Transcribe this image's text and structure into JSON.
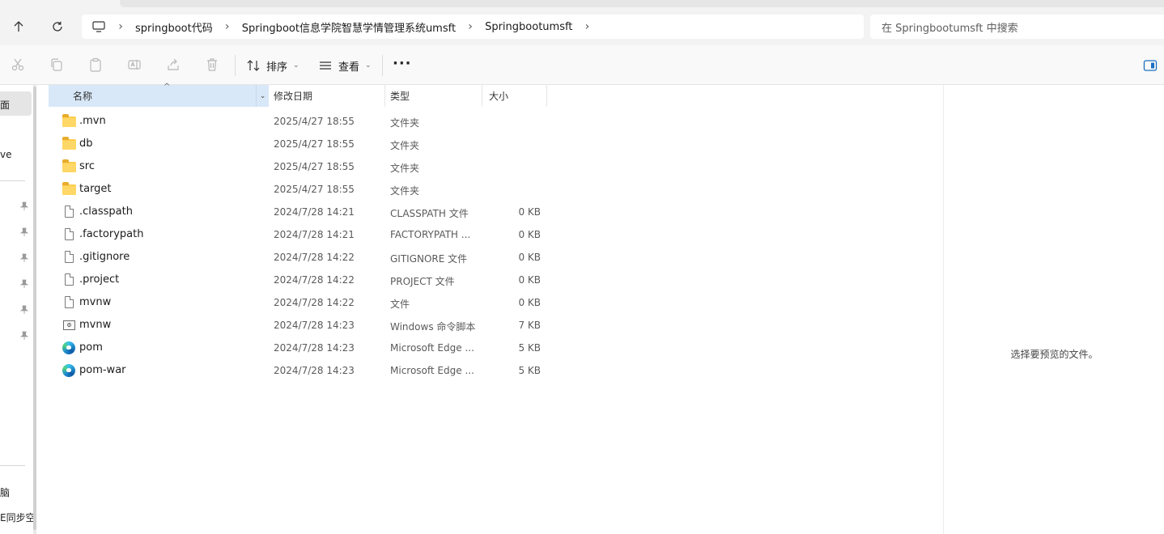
{
  "address": {
    "breadcrumbs": [
      "springboot代码",
      "Springboot信息学院智慧学情管理系统umsft",
      "Springbootumsft"
    ],
    "search_placeholder": "在 Springbootumsft 中搜索"
  },
  "toolbar": {
    "sort_label": "排序",
    "view_label": "查看",
    "more_label": "···"
  },
  "left_nav": {
    "selected_fragment": "面",
    "fragment_1": "ve",
    "fragment_2": "脑",
    "fragment_3": "E同步空"
  },
  "columns": {
    "name": "名称",
    "date": "修改日期",
    "type": "类型",
    "size": "大小"
  },
  "files": [
    {
      "name": ".mvn",
      "date": "2025/4/27 18:55",
      "type": "文件夹",
      "size": "",
      "icon": "folder-icon"
    },
    {
      "name": "db",
      "date": "2025/4/27 18:55",
      "type": "文件夹",
      "size": "",
      "icon": "folder-icon"
    },
    {
      "name": "src",
      "date": "2025/4/27 18:55",
      "type": "文件夹",
      "size": "",
      "icon": "folder-icon"
    },
    {
      "name": "target",
      "date": "2025/4/27 18:55",
      "type": "文件夹",
      "size": "",
      "icon": "folder-icon"
    },
    {
      "name": ".classpath",
      "date": "2024/7/28 14:21",
      "type": "CLASSPATH 文件",
      "size": "0 KB",
      "icon": "file-icon"
    },
    {
      "name": ".factorypath",
      "date": "2024/7/28 14:21",
      "type": "FACTORYPATH ...",
      "size": "0 KB",
      "icon": "file-icon"
    },
    {
      "name": ".gitignore",
      "date": "2024/7/28 14:22",
      "type": "GITIGNORE 文件",
      "size": "0 KB",
      "icon": "file-icon"
    },
    {
      "name": ".project",
      "date": "2024/7/28 14:22",
      "type": "PROJECT 文件",
      "size": "0 KB",
      "icon": "file-icon"
    },
    {
      "name": "mvnw",
      "date": "2024/7/28 14:22",
      "type": "文件",
      "size": "0 KB",
      "icon": "file-icon"
    },
    {
      "name": "mvnw",
      "date": "2024/7/28 14:23",
      "type": "Windows 命令脚本",
      "size": "7 KB",
      "icon": "cmd-script-icon"
    },
    {
      "name": "pom",
      "date": "2024/7/28 14:23",
      "type": "Microsoft Edge ...",
      "size": "5 KB",
      "icon": "edge-icon"
    },
    {
      "name": "pom-war",
      "date": "2024/7/28 14:23",
      "type": "Microsoft Edge ...",
      "size": "5 KB",
      "icon": "edge-icon"
    }
  ],
  "preview": {
    "empty_text": "选择要预览的文件。"
  }
}
